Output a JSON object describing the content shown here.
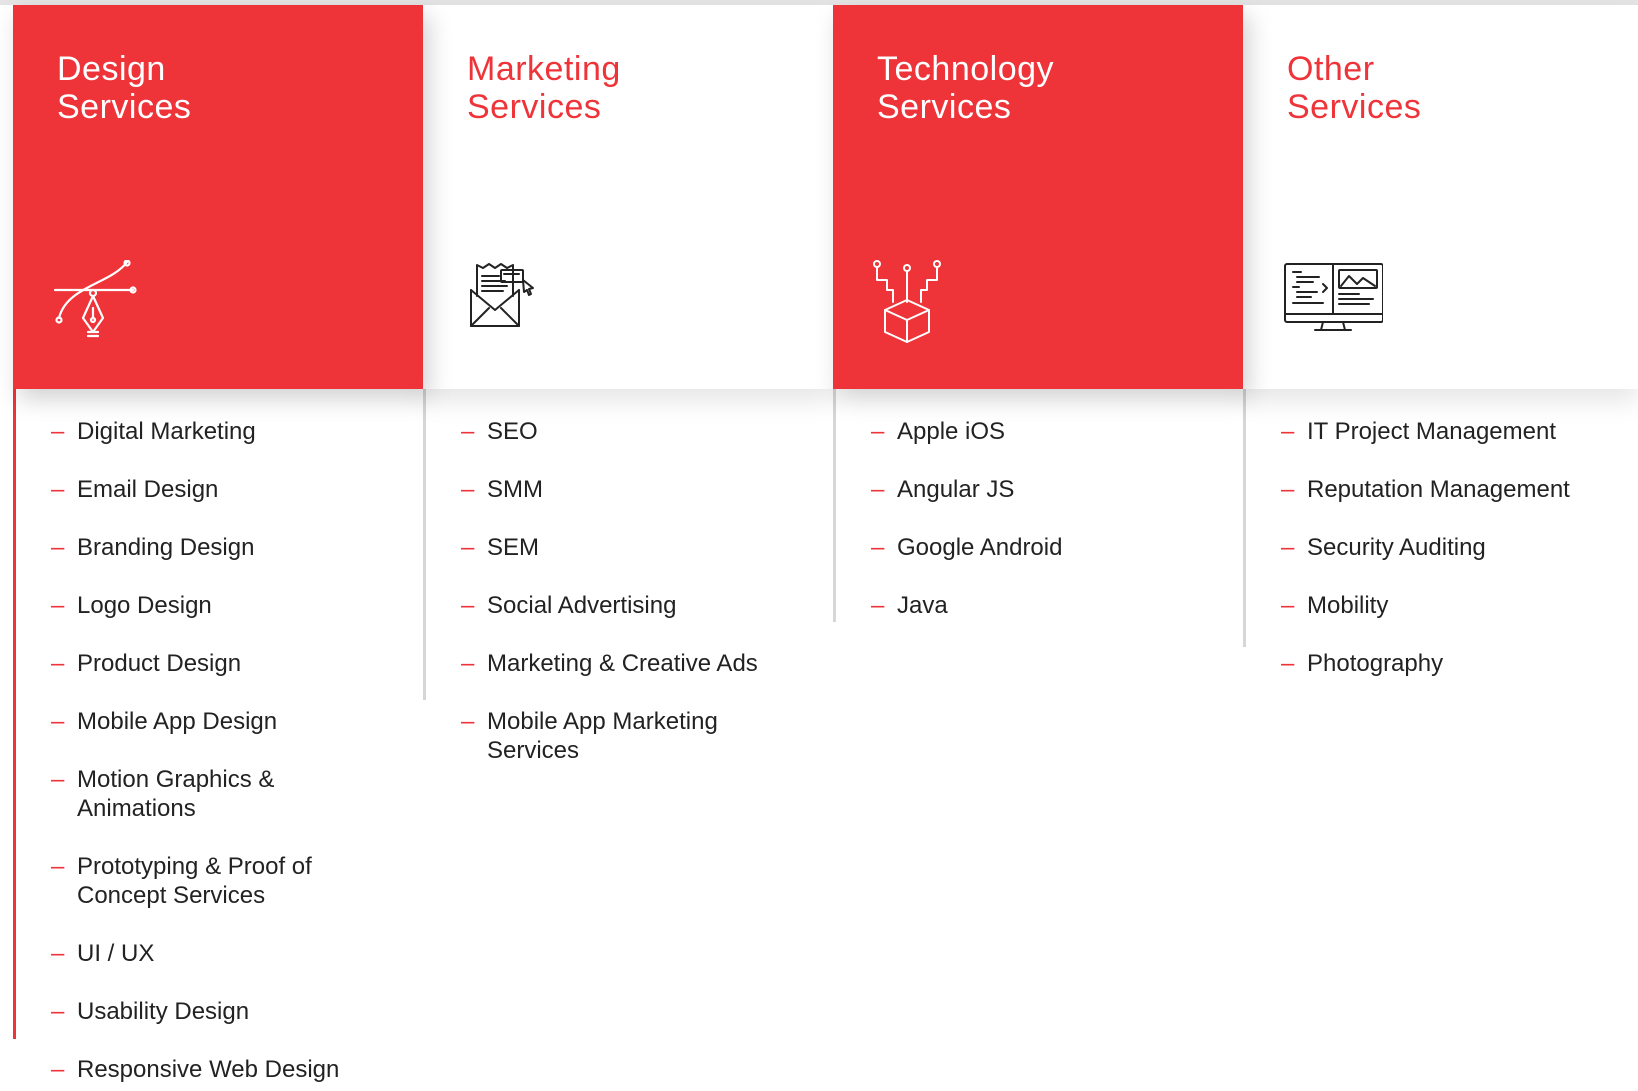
{
  "columns": [
    {
      "title_line1": "Design",
      "title_line2": "Services",
      "icon": "pen-tool-bezier-icon",
      "items": [
        "Digital Marketing",
        "Email Design",
        "Branding Design",
        "Logo Design",
        "Product Design",
        "Mobile App Design",
        "Motion Graphics & Animations",
        "Prototyping & Proof of Concept Services",
        "UI / UX",
        "Usability Design",
        "Responsive Web Design"
      ]
    },
    {
      "title_line1": "Marketing",
      "title_line2": "Services",
      "icon": "email-newsletter-icon",
      "items": [
        "SEO",
        "SMM",
        "SEM",
        "Social Advertising",
        "Marketing & Creative Ads",
        "Mobile App Marketing Services"
      ]
    },
    {
      "title_line1": "Technology",
      "title_line2": "Services",
      "icon": "circuit-box-icon",
      "items": [
        "Apple iOS",
        "Angular JS",
        "Google Android",
        "Java"
      ]
    },
    {
      "title_line1": "Other",
      "title_line2": "Services",
      "icon": "desktop-monitor-icon",
      "items": [
        "IT Project Management",
        "Reputation Management",
        "Security Auditing",
        "Mobility",
        "Photography"
      ]
    }
  ],
  "list_marker": "–",
  "colors": {
    "accent": "#ee3339",
    "text": "#222222",
    "rule": "#d6d6d6"
  }
}
